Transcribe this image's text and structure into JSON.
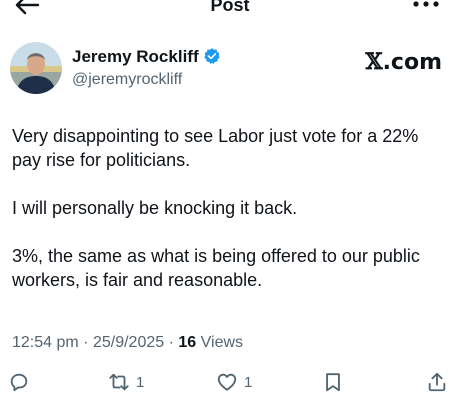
{
  "header": {
    "title": "Post",
    "back_icon": "arrow-left-icon",
    "more_icon": "more-horizontal-icon"
  },
  "author": {
    "display_name": "Jeremy Rockliff",
    "handle": "@jeremyrockliff",
    "verified": true,
    "verified_color": "#1d9bf0",
    "avatar_icon": "profile-photo"
  },
  "brand": {
    "mark": "𝕏",
    "suffix": ".com"
  },
  "post": {
    "paragraphs": [
      "Very disappointing to see Labor just vote for a 22% pay rise for politicians.",
      "I will personally be knocking it back.",
      "3%, the same as what is being offered to our public workers, is fair and reasonable."
    ]
  },
  "meta": {
    "time": "12:54 pm",
    "separator": "·",
    "date": "25/9/2025",
    "views_count": "16",
    "views_label": "Views"
  },
  "actions": {
    "reply": {
      "icon": "reply-icon",
      "count": ""
    },
    "repost": {
      "icon": "repost-icon",
      "count": "1"
    },
    "like": {
      "icon": "heart-icon",
      "count": "1"
    },
    "bookmark": {
      "icon": "bookmark-icon",
      "count": ""
    },
    "share": {
      "icon": "share-icon",
      "count": ""
    }
  },
  "colors": {
    "text": "#0f1419",
    "secondary": "#536471",
    "accent": "#1d9bf0"
  }
}
